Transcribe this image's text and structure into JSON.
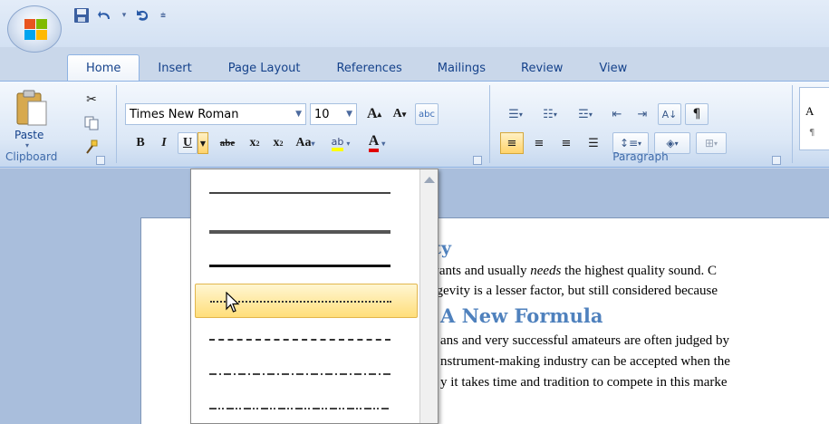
{
  "quick_access": {
    "icons": [
      "save-icon",
      "undo-icon",
      "redo-icon",
      "customize-icon"
    ]
  },
  "tabs": [
    {
      "label": "Home",
      "active": true
    },
    {
      "label": "Insert",
      "active": false
    },
    {
      "label": "Page Layout",
      "active": false
    },
    {
      "label": "References",
      "active": false
    },
    {
      "label": "Mailings",
      "active": false
    },
    {
      "label": "Review",
      "active": false
    },
    {
      "label": "View",
      "active": false
    }
  ],
  "clipboard": {
    "paste_label": "Paste",
    "group_label": "Clipboard"
  },
  "font": {
    "family": "Times New Roman",
    "size": "10",
    "grow_glyph": "A",
    "shrink_glyph": "A",
    "bold": "B",
    "italic": "I",
    "underline": "U",
    "strike": "abe",
    "subscript": "x",
    "superscript": "x",
    "change_case": "Aa",
    "highlight": "ab",
    "font_color": "A"
  },
  "paragraph": {
    "group_label": "Paragraph"
  },
  "styles": {
    "preview_text": "A"
  },
  "document": {
    "heading1": "ity",
    "line1_a": "wants and usually ",
    "line1_em": "needs",
    "line1_b": " the highest quality sound. C",
    "line2": "ngevity is a lesser factor, but still considered because",
    "heading2": "A New Formula",
    "line3": "ans and very successful amateurs are often judged by",
    "line4": "nstrument-making industry can be accepted when the",
    "line5": "y it takes time and tradition to compete in this marke"
  },
  "underline_menu": {
    "options": [
      "single",
      "double",
      "thick",
      "dotted",
      "dashed",
      "dot-dash",
      "dot-dot-dash"
    ],
    "hovered": "dotted"
  },
  "colors": {
    "ribbon_border": "#8db2e3",
    "heading_blue": "#4f81bd",
    "hover_gold": "#ffd36b",
    "font_color_red": "#e00000"
  }
}
